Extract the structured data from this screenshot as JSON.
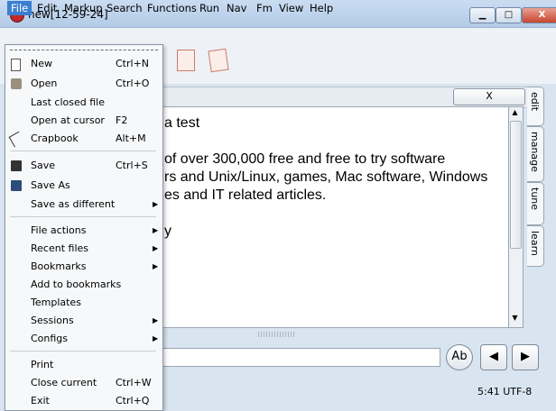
{
  "window": {
    "title": "new[12-59-24]",
    "minimize": "▁",
    "maximize": "□",
    "close": "X"
  },
  "menubar": [
    "File",
    "Edit",
    "Markup",
    "Search",
    "Functions",
    "Run",
    "Nav",
    "Fm",
    "View",
    "Help"
  ],
  "file_menu": {
    "items": [
      {
        "label": "New",
        "shortcut": "Ctrl+N",
        "icon": "new-file-icon"
      },
      {
        "label": "Open",
        "shortcut": "Ctrl+O",
        "icon": "open-folder-icon"
      },
      {
        "label": "Last closed file",
        "shortcut": ""
      },
      {
        "label": "Open at cursor",
        "shortcut": "F2"
      },
      {
        "label": "Crapbook",
        "shortcut": "Alt+M",
        "icon": "crapbook-icon"
      },
      {
        "label": "Save",
        "shortcut": "Ctrl+S",
        "icon": "save-icon"
      },
      {
        "label": "Save As",
        "shortcut": "",
        "icon": "save-as-icon"
      },
      {
        "label": "Save as different",
        "shortcut": "",
        "submenu": true
      },
      {
        "label": "File actions",
        "shortcut": "",
        "submenu": true
      },
      {
        "label": "Recent files",
        "shortcut": "",
        "submenu": true
      },
      {
        "label": "Bookmarks",
        "shortcut": "",
        "submenu": true
      },
      {
        "label": "Add to bookmarks",
        "shortcut": ""
      },
      {
        "label": "Templates",
        "shortcut": ""
      },
      {
        "label": "Sessions",
        "shortcut": "",
        "submenu": true
      },
      {
        "label": "Configs",
        "shortcut": "",
        "submenu": true
      },
      {
        "label": "Print",
        "shortcut": ""
      },
      {
        "label": "Close current",
        "shortcut": "Ctrl+W"
      },
      {
        "label": "Exit",
        "shortcut": "Ctrl+Q"
      }
    ]
  },
  "editor": {
    "tab_close": "X",
    "lines": [
      "a test",
      "",
      "of over 300,000 free and free to try software",
      "rs and Unix/Linux, games, Mac software, Windows",
      "es and IT related articles.",
      "",
      "y"
    ]
  },
  "side_tabs": [
    "edit",
    "manage",
    "tune",
    "learn"
  ],
  "bottom": {
    "find_button": "Ab",
    "prev": "◀",
    "next": "▶"
  },
  "status": "5:41 UTF-8",
  "colors": {
    "menu_active": "#3b7fd1",
    "title_bar": "#c9dcf1",
    "close_button": "#c7472f"
  }
}
